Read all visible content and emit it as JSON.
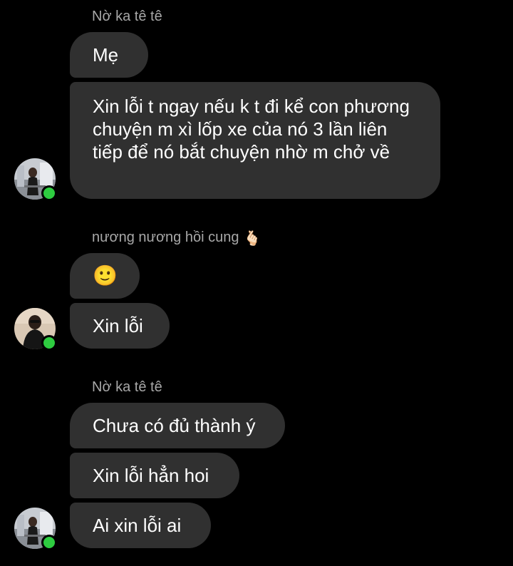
{
  "groups": [
    {
      "sender": "Nờ ka tê tê",
      "messages": [
        "Mẹ",
        "Xin lỗi t ngay nếu k t đi kể con phương chuyện m xì lốp xe của nó 3 lần liên tiếp để nó bắt chuyện nhờ m chở về"
      ]
    },
    {
      "sender": "nương nương hồi cung",
      "sender_emoji": "🫰🏻",
      "messages": [
        "🙂",
        "Xin lỗi"
      ]
    },
    {
      "sender": "Nờ ka tê tê",
      "messages": [
        "Chưa có đủ thành ý",
        "Xin lỗi hẳn hoi",
        "Ai xin lỗi ai"
      ]
    }
  ],
  "colors": {
    "background": "#000000",
    "bubble": "#303030",
    "sender_name": "#a8a8a8",
    "online": "#2ecc40"
  },
  "icons": {
    "online_indicator": "online-status-dot"
  }
}
